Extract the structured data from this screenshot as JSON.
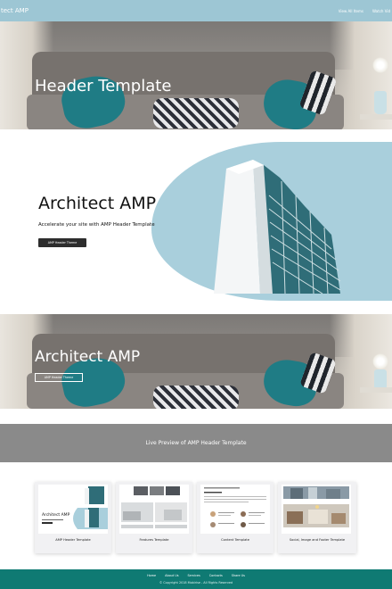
{
  "nav": {
    "brand": "tect AMP",
    "links": [
      "View All Items",
      "Watch Vid"
    ]
  },
  "hero1": {
    "title": "Header Template"
  },
  "architect": {
    "title": "Architect AMP",
    "subtitle": "Accelerate your site with AMP Header Template",
    "button": "AMP Header Theme"
  },
  "hero2": {
    "title": "Architect AMP",
    "button": "AMP Header Theme"
  },
  "live_preview": {
    "text": "Live Preview of AMP Header Template"
  },
  "cards": [
    {
      "label": "AMP Header Template",
      "thumb_title": "Architect AMP"
    },
    {
      "label": "Features Template"
    },
    {
      "label": "Content Template"
    },
    {
      "label": "Social, Image and Footer Template"
    }
  ],
  "footer": {
    "links": [
      "Home",
      "About Us",
      "Services",
      "Contacts",
      "Share Us"
    ],
    "copyright": "© Copyright 2018 Mobirise - All Rights Reserved"
  },
  "colors": {
    "nav_bg": "#9dc6d4",
    "accent_blue": "#a9cfdc",
    "teal_pillow": "#1f7c85",
    "preview_band": "#8a8a8a",
    "footer_bg": "#0f7a73"
  }
}
